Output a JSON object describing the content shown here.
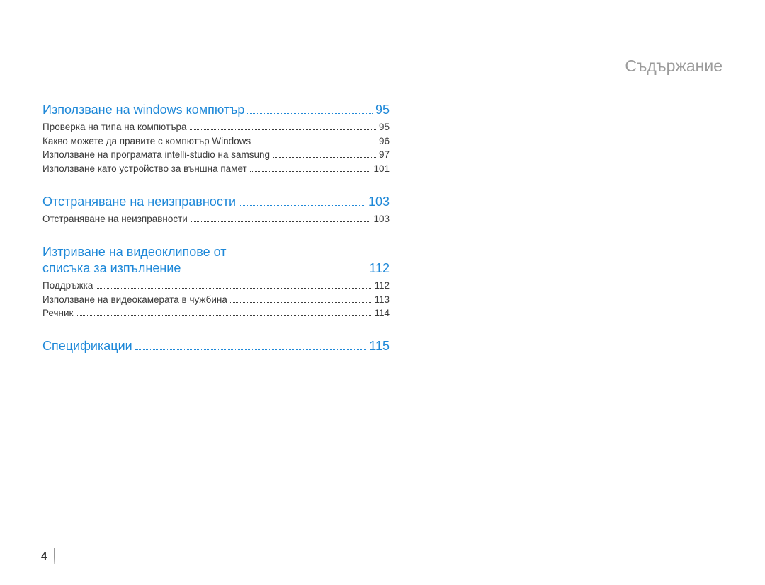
{
  "header": {
    "title": "Съдържание"
  },
  "sections": [
    {
      "title": "Използване на windows компютър",
      "page": "95",
      "items": [
        {
          "label": "Проверка на типа на компютъра",
          "page": "95"
        },
        {
          "label": "Какво можете да правите с компютър Windows",
          "page": "96"
        },
        {
          "label": "Използване на програмата intelli-studio на samsung",
          "page": "97"
        },
        {
          "label": "Използване като устройство за външна памет",
          "page": "101"
        }
      ]
    },
    {
      "title": "Отстраняване на неизправности",
      "page": "103",
      "items": [
        {
          "label": "Отстраняване на неизправности",
          "page": "103"
        }
      ]
    },
    {
      "title_line1": "Изтриване на видеоклипове от",
      "title_line2": "списъка за изпълнение",
      "page": "112",
      "items": [
        {
          "label": "Поддръжка",
          "page": "112"
        },
        {
          "label": "Използване на видеокамерата в чужбина",
          "page": "113"
        },
        {
          "label": "Речник",
          "page": "114"
        }
      ]
    },
    {
      "title": "Спецификации",
      "page": "115",
      "items": []
    }
  ],
  "footer": {
    "page_number": "4"
  }
}
